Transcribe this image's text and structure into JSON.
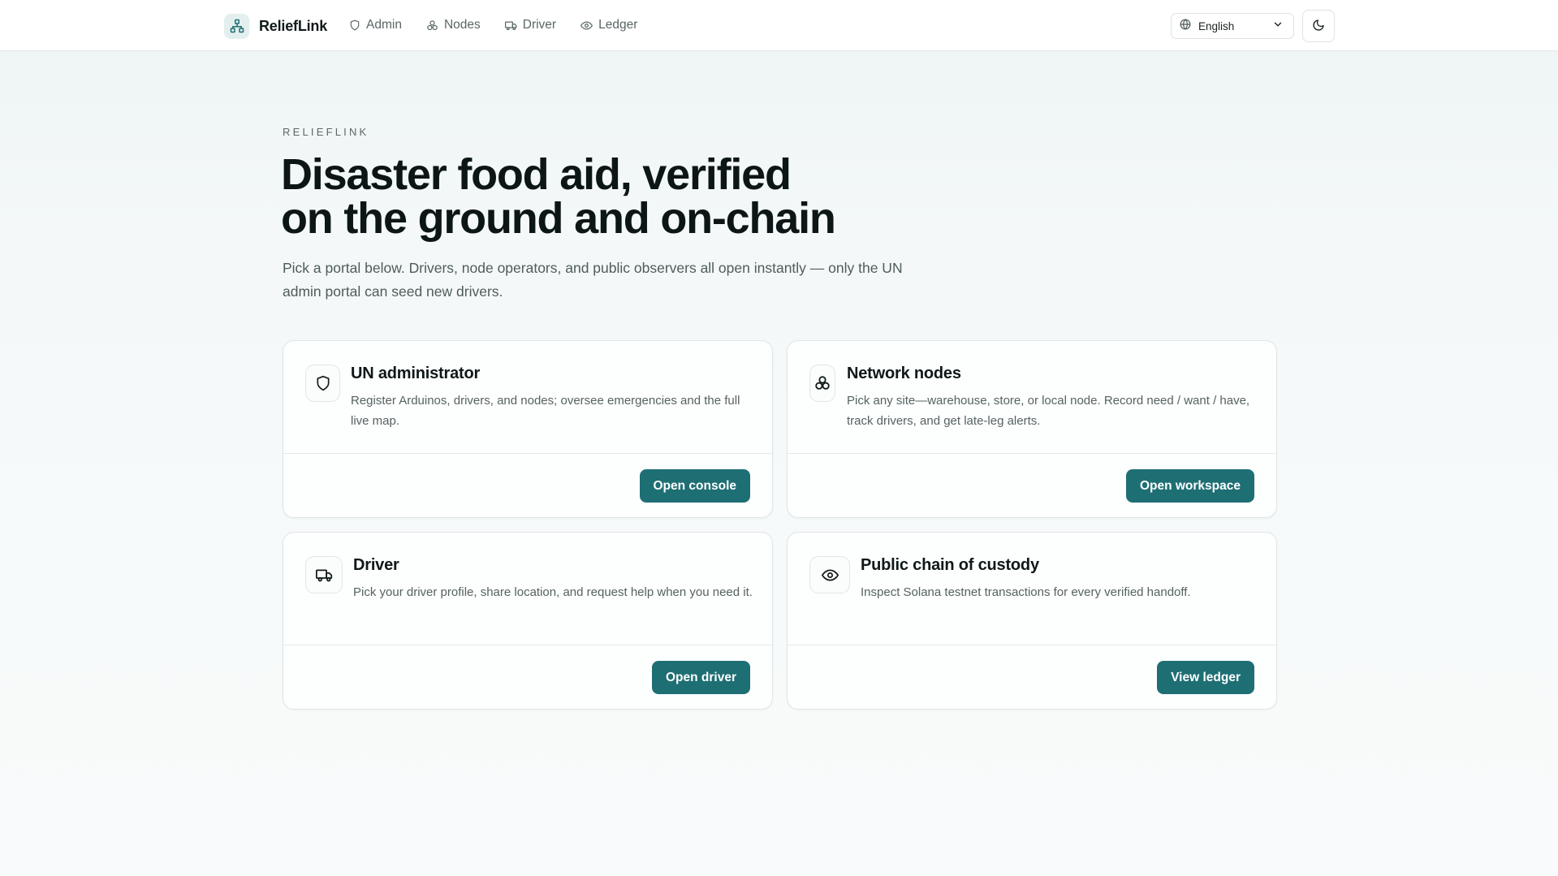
{
  "header": {
    "brand": "ReliefLink",
    "nav": [
      {
        "label": "Admin",
        "icon": "shield-icon"
      },
      {
        "label": "Nodes",
        "icon": "nodes-icon"
      },
      {
        "label": "Driver",
        "icon": "truck-icon"
      },
      {
        "label": "Ledger",
        "icon": "eye-icon"
      }
    ],
    "language": "English",
    "theme_icon": "moon-icon"
  },
  "hero": {
    "eyebrow": "RELIEFLINK",
    "title_line1": "Disaster food aid, verified",
    "title_line2": "on the ground and on-chain",
    "subtitle": "Pick a portal below. Drivers, node operators, and public observers all open instantly — only the UN admin portal can seed new drivers."
  },
  "cards": [
    {
      "title": "UN administrator",
      "description": "Register Arduinos, drivers, and nodes; oversee emergencies and the full live map.",
      "button": "Open console",
      "icon": "shield-icon"
    },
    {
      "title": "Network nodes",
      "description": "Pick any site—warehouse, store, or local node. Record need / want / have, track drivers, and get late-leg alerts.",
      "button": "Open workspace",
      "icon": "nodes-icon"
    },
    {
      "title": "Driver",
      "description": "Pick your driver profile, share location, and request help when you need it.",
      "button": "Open driver",
      "icon": "truck-icon"
    },
    {
      "title": "Public chain of custody",
      "description": "Inspect Solana testnet transactions for every verified handoff.",
      "button": "View ledger",
      "icon": "eye-icon"
    }
  ],
  "colors": {
    "accent": "#1e6f74",
    "brand_icon_bg": "#e3efee",
    "text_primary": "#0f1818",
    "text_muted": "#566262"
  }
}
